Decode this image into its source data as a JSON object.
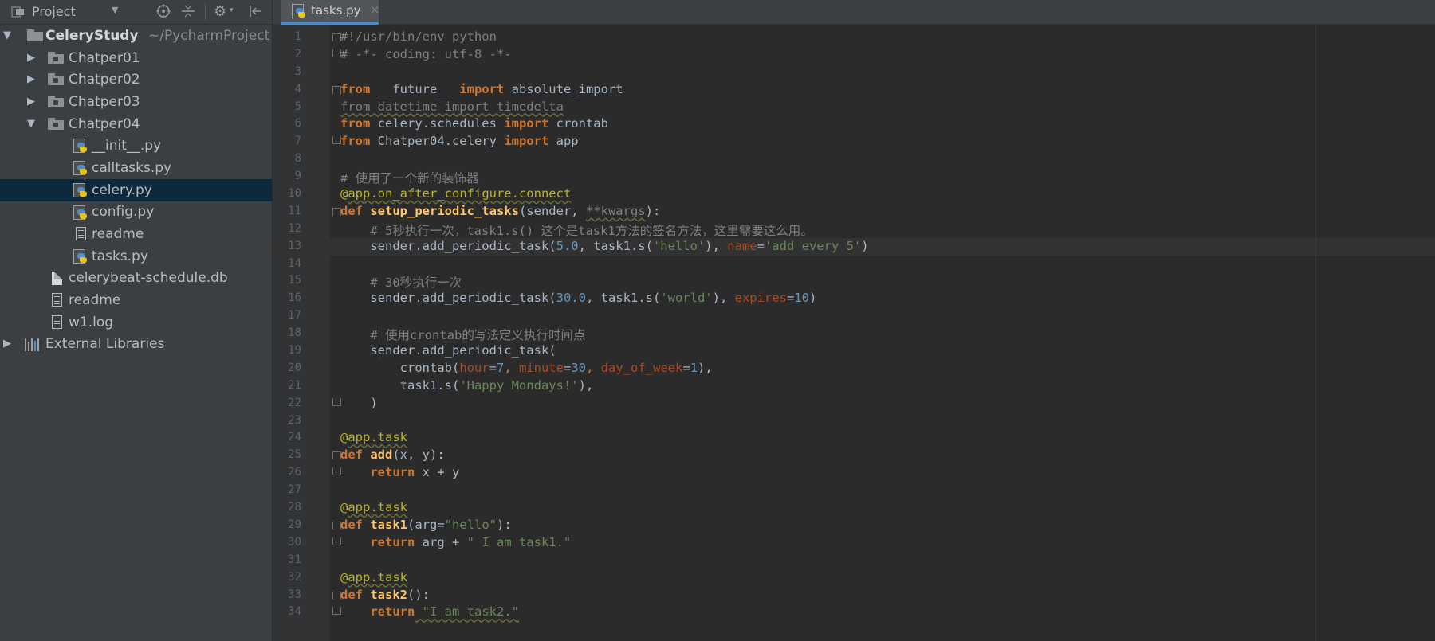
{
  "toolbar": {
    "view_label": "Project",
    "icons": [
      "project-view-icon",
      "chevron-down-icon",
      "locate-icon",
      "collapse-icon",
      "gear-icon",
      "hide-icon"
    ]
  },
  "tree": {
    "root": {
      "name": "CeleryStudy",
      "path": "~/PycharmProject"
    },
    "folders": [
      "Chatper01",
      "Chatper02",
      "Chatper03",
      "Chatper04"
    ],
    "chatper04_files": [
      "__init__.py",
      "calltasks.py",
      "celery.py",
      "config.py",
      "readme",
      "tasks.py"
    ],
    "root_files": [
      "celerybeat-schedule.db",
      "readme",
      "w1.log"
    ],
    "external": "External Libraries",
    "selected": "celery.py"
  },
  "tabs": [
    {
      "label": "tasks.py",
      "close": "×"
    }
  ],
  "editor": {
    "line_numbers": [
      "1",
      "2",
      "3",
      "4",
      "5",
      "6",
      "7",
      "8",
      "9",
      "10",
      "11",
      "12",
      "13",
      "14",
      "15",
      "16",
      "17",
      "18",
      "19",
      "20",
      "21",
      "22",
      "23",
      "24",
      "25",
      "26",
      "27",
      "28",
      "29",
      "30",
      "31",
      "32",
      "33",
      "34"
    ],
    "current_line": 13
  },
  "code": {
    "l1": "#!/usr/bin/env python",
    "l2": "# -*- coding: utf-8 -*-",
    "l4_from": "from",
    "l4_mod": " __future__ ",
    "l4_import": "import",
    "l4_name": " absolute_import",
    "l5": "from datetime import timedelta",
    "l6_from": "from",
    "l6_mod": " celery.schedules ",
    "l6_import": "import",
    "l6_name": " crontab",
    "l7_from": "from",
    "l7_mod": " Chatper04.celery ",
    "l7_import": "import",
    "l7_name": " app",
    "l9": "# 使用了一个新的装饰器",
    "l10_at": "@",
    "l10_dec": "app.on_after_configure.connect",
    "l11_def": "def",
    "l11_fn": " setup_periodic_tasks",
    "l11_a": "(sender, ",
    "l11_kw": "**kwargs",
    "l11_b": "):",
    "l12": "    # 5秒执行一次，task1.s() 这个是task1方法的签名方法，这里需要这么用。",
    "l13_a": "    sender.add_periodic_task(",
    "l13_n": "5.0",
    "l13_b": ", task1.s(",
    "l13_s": "'hello'",
    "l13_c": "), ",
    "l13_p": "name",
    "l13_eq": "=",
    "l13_s2": "'add every 5'",
    "l13_d": ")",
    "l15": "    # 30秒执行一次",
    "l16_a": "    sender.add_periodic_task(",
    "l16_n": "30.0",
    "l16_b": ", task1.s(",
    "l16_s": "'world'",
    "l16_c": "), ",
    "l16_p": "expires",
    "l16_eq": "=",
    "l16_n2": "10",
    "l16_d": ")",
    "l18": "    # 使用crontab的写法定义执行时间点",
    "l19": "    sender.add_periodic_task(",
    "l20_a": "        crontab(",
    "l20_p1": "hour",
    "l20_v1": "7",
    "l20_p2": "minute",
    "l20_v2": "30",
    "l20_p3": "day_of_week",
    "l20_v3": "1",
    "l20_b": "),",
    "l21_a": "        task1.s(",
    "l21_s": "'Happy Mondays!'",
    "l21_b": "),",
    "l22": "    )",
    "l24_at": "@",
    "l24_dec": "app.task",
    "l25_def": "def",
    "l25_fn": " add",
    "l25_a": "(x, y):",
    "l26_kw": "    return",
    "l26_a": " x + y",
    "l28_at": "@",
    "l28_dec": "app.task",
    "l29_def": "def",
    "l29_fn": " task1",
    "l29_a": "(arg=",
    "l29_s": "\"hello\"",
    "l29_b": "):",
    "l30_kw": "    return",
    "l30_a": " arg + ",
    "l30_s": "\" I am task1.\"",
    "l32_at": "@",
    "l32_dec": "app.task",
    "l33_def": "def",
    "l33_fn": " task2",
    "l33_a": "():",
    "l34_kw": "    return",
    "l34_s": " \"I am task2.\""
  }
}
